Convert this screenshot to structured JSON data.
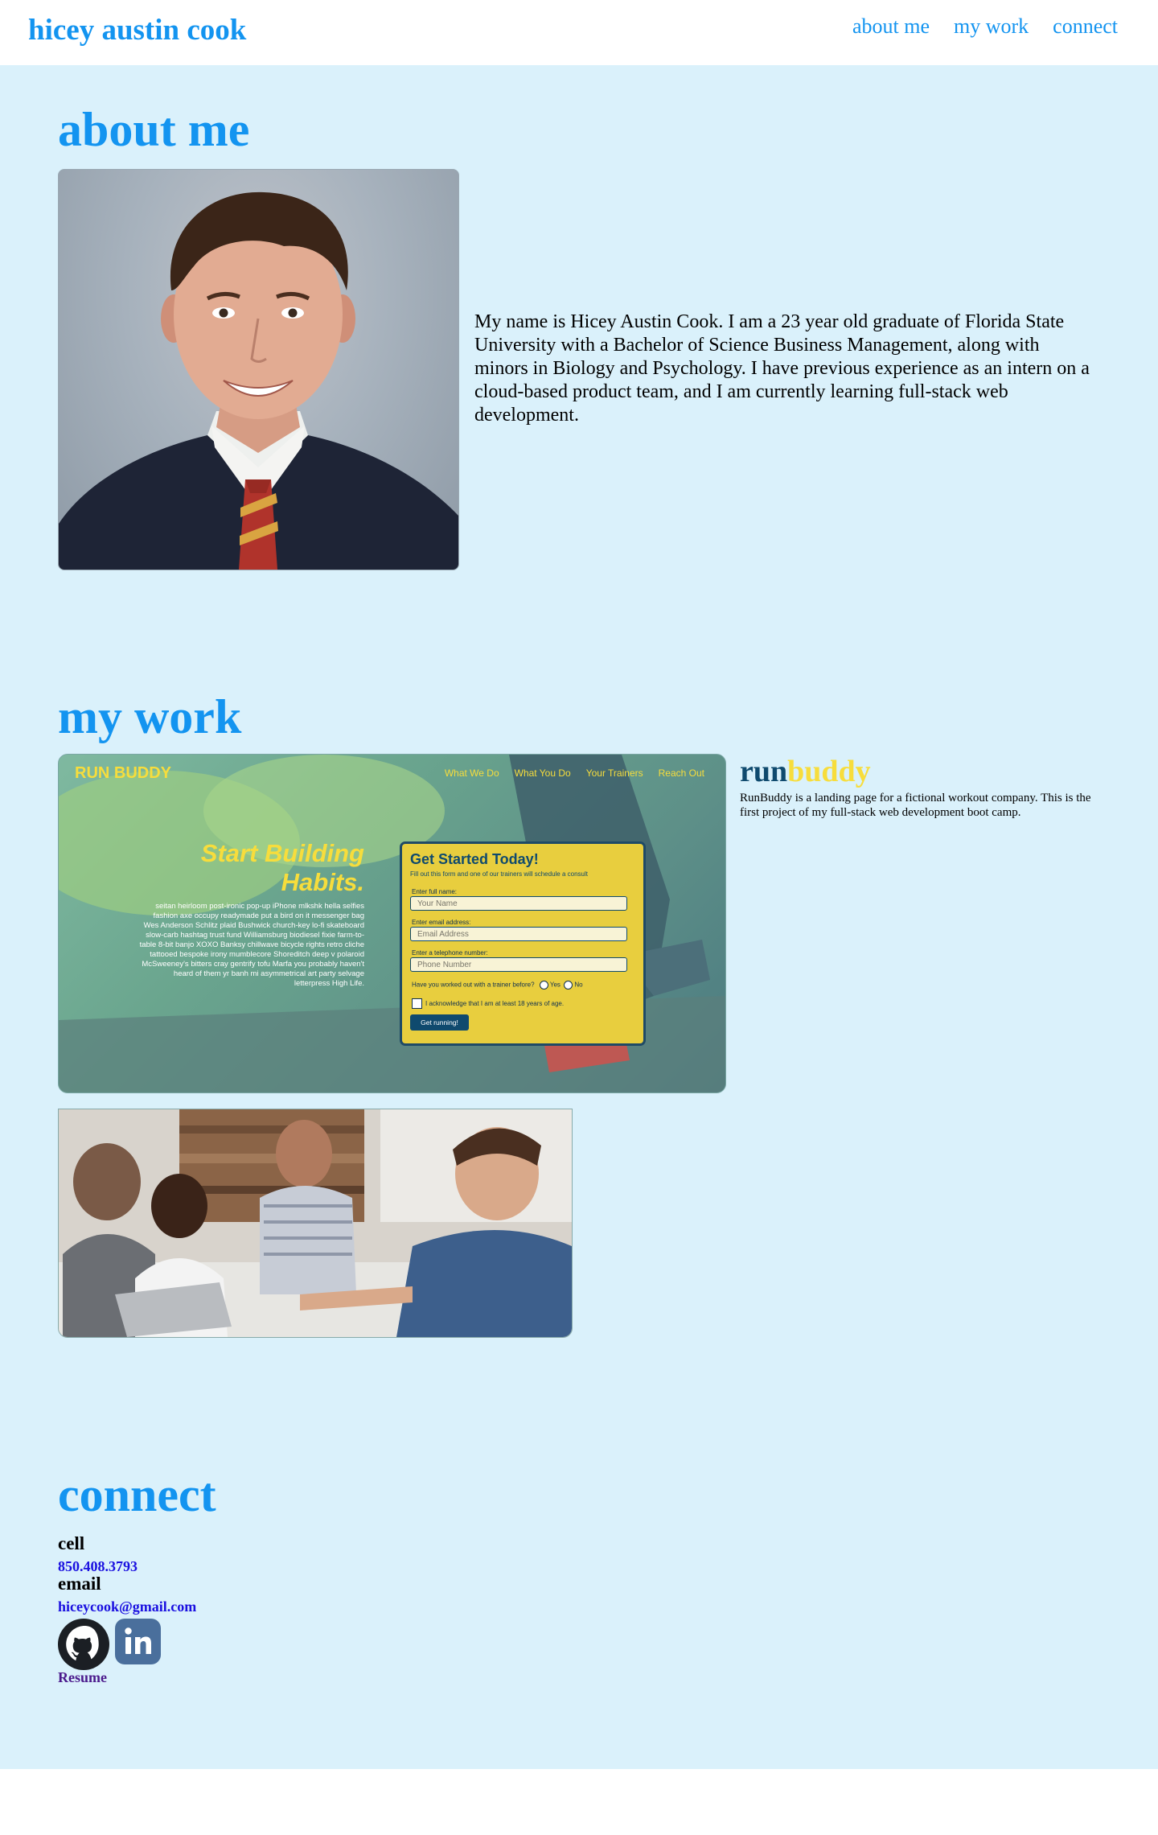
{
  "header": {
    "brand": "hicey austin cook",
    "nav": [
      "about me",
      "my work",
      "connect"
    ]
  },
  "about": {
    "title": "about me",
    "bio": "My name is Hicey Austin Cook. I am a 23 year old graduate of Florida State University with a Bachelor of Science Business Management, along with minors in Biology and Psychology. I have previous experience as an intern on a cloud-based product team, and I am currently learning full-stack web development."
  },
  "work": {
    "title": "my work",
    "project": {
      "title_part1": "run",
      "title_part2": "buddy",
      "description": "RunBuddy is a landing page for a fictional workout company. This is the first project of my full-stack web development boot camp.",
      "screenshot": {
        "brand": "RUN BUDDY",
        "nav": [
          "What We Do",
          "What You Do",
          "Your Trainers",
          "Reach Out"
        ],
        "hero_line1": "Start Building",
        "hero_line2": "Habits.",
        "filler": "seitan heirloom post-ironic pop-up iPhone mlkshk hella selfies fashion axe occupy readymade put a bird on it messenger bag Wes Anderson Schlitz plaid Bushwick church-key lo-fi skateboard slow-carb hashtag trust fund Williamsburg biodiesel fixie farm-to-table 8-bit banjo XOXO Banksy chillwave bicycle rights retro cliche tattooed bespoke irony mumblecore Shoreditch deep v polaroid McSweeney's bitters cray gentrify tofu Marfa you probably haven't heard of them yr banh mi asymmetrical art party selvage letterpress High Life.",
        "form_title": "Get Started Today!",
        "form_subtitle": "Fill out this form and one of our trainers will schedule a consult",
        "field1_label": "Enter full name:",
        "field1_placeholder": "Your Name",
        "field2_label": "Enter email address:",
        "field2_placeholder": "Email Address",
        "field3_label": "Enter a telephone number:",
        "field3_placeholder": "Phone Number",
        "radio_question": "Have you worked out with a trainer before?",
        "radio_yes": "Yes",
        "radio_no": "No",
        "checkbox_label": "I acknowledge that I am at least 18 years of age.",
        "button": "Get running!"
      }
    }
  },
  "connect": {
    "title": "connect",
    "cell_label": "cell",
    "cell_value": "850.408.3793",
    "email_label": "email",
    "email_value": "hiceycook@gmail.com",
    "icons": [
      "github-icon",
      "linkedin-icon"
    ],
    "resume_label": "Resume"
  },
  "colors": {
    "accent": "#1394f0",
    "content_bg": "#daf1fb",
    "runbuddy_yellow": "#f7dd3c",
    "runbuddy_navy": "#0f4a6e",
    "link": "#1a10e0",
    "visited_link": "#4b1a8c"
  }
}
